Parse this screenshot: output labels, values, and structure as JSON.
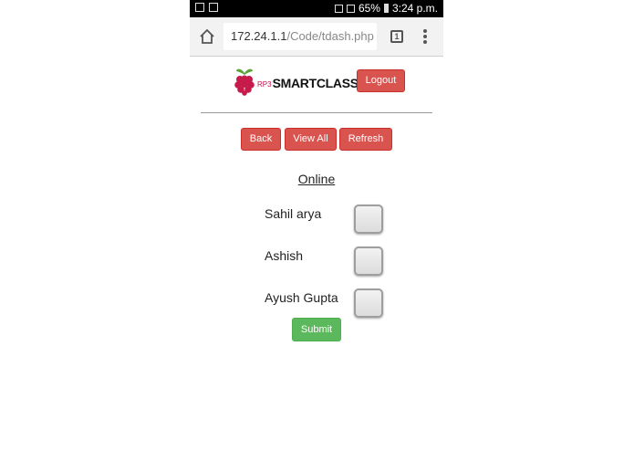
{
  "status_bar": {
    "battery_percent": "65%",
    "time": "3:24 p.m."
  },
  "browser": {
    "url_host": "172.24.1.1",
    "url_path": "/Code/tdash.php",
    "tab_count": "1"
  },
  "header": {
    "logo_prefix": "RP3",
    "logo_brand": "SMARTCLASS",
    "logout_label": "Logout"
  },
  "nav": {
    "back_label": "Back",
    "view_all_label": "View All",
    "refresh_label": "Refresh"
  },
  "section_title": "Online",
  "students": [
    {
      "name": "Sahil arya",
      "checked": false
    },
    {
      "name": "Ashish",
      "checked": false
    },
    {
      "name": "Ayush Gupta",
      "checked": false
    }
  ],
  "submit_label": "Submit",
  "colors": {
    "danger": "#d9534f",
    "success": "#5cb85c"
  }
}
